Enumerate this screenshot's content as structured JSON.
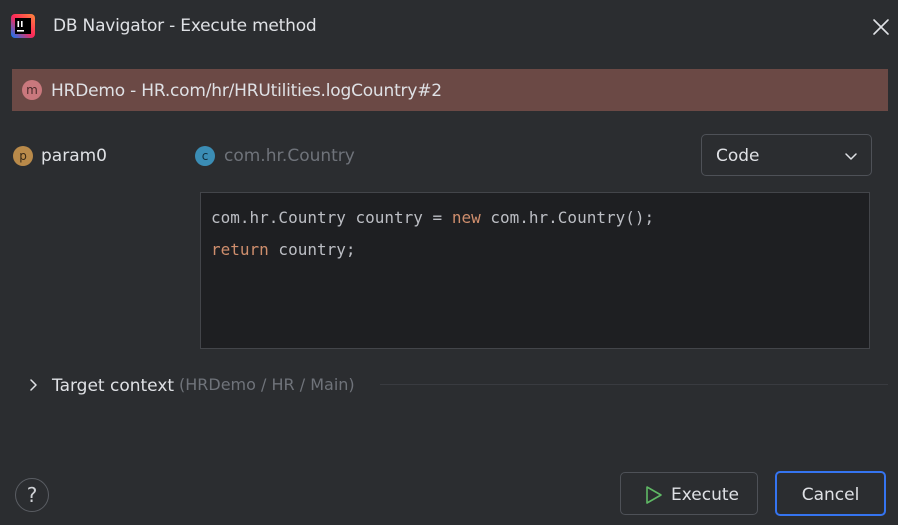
{
  "window": {
    "title": "DB Navigator - Execute method",
    "app_icon": "intellij-idea-icon",
    "close_icon": "close-icon"
  },
  "method": {
    "badge": "m",
    "signature": "HRDemo - HR.com/hr/HRUtilities.logCountry#2",
    "header_color": "#6b4945"
  },
  "parameter": {
    "badge": "p",
    "name": "param0",
    "type_badge": "c",
    "type": "com.hr.Country",
    "mode": "Code",
    "mode_icon": "chevron-down-icon"
  },
  "code": {
    "line1_a": "com.hr.Country country = ",
    "line1_kw": "new",
    "line1_b": " com.hr.Country();",
    "line2_kw": "return",
    "line2_b": " country;",
    "keyword_color": "#cf8e6d"
  },
  "target_context": {
    "label": "Target context",
    "path": "(HRDemo / HR / Main)"
  },
  "footer": {
    "help": "?",
    "execute_label": "Execute",
    "execute_icon": "play-icon",
    "cancel_label": "Cancel",
    "accent": "#3574f0"
  }
}
